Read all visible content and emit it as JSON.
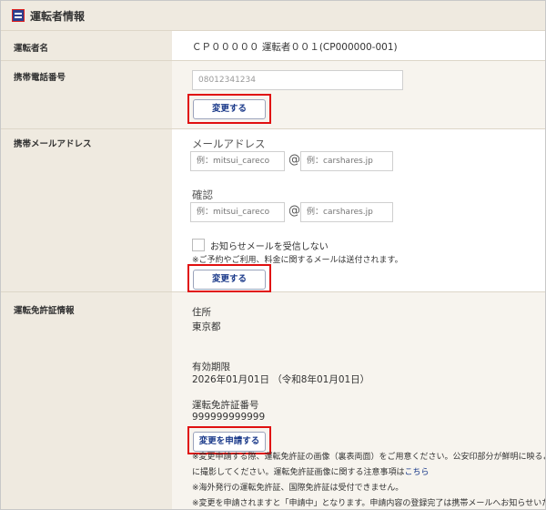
{
  "header": {
    "title": "運転者情報"
  },
  "driver_name": {
    "label": "運転者名",
    "value": "ＣＰ０００００ 運転者００１(CP000000-001)"
  },
  "mobile_phone": {
    "label": "携帯電話番号",
    "input_value": "08012341234",
    "button": "変更する"
  },
  "mobile_email": {
    "label": "携帯メールアドレス",
    "email_heading": "メールアドレス",
    "local_placeholder": "例：mitsui_careco",
    "at": "@",
    "domain_placeholder": "例：carshares.jp",
    "confirm_heading": "確認",
    "notify_checkbox_label": "お知らせメールを受信しない",
    "notify_note": "※ご予約やご利用、料金に関するメールは送付されます。",
    "button": "変更する"
  },
  "license": {
    "label": "運転免許証情報",
    "address_label": "住所",
    "address_value": "東京都",
    "expiry_label": "有効期限",
    "expiry_value": "2026年01月01日 （令和8年01月01日）",
    "number_label": "運転免許証番号",
    "number_value": "999999999999",
    "button": "変更を申請する",
    "note1": "※変更申請する際、運転免許証の画像（裏表両面）をご用意ください。公安印部分が鮮明に映るよう",
    "note2_prefix": "に撮影してください。運転免許証画像に関する注意事項は",
    "note2_link": "こちら",
    "note3": "※海外発行の運転免許証、国際免許証は受付できません。",
    "note4": "※変更を申請されますと「申請中」となります。申請内容の登録完了は携帯メールへお知らせいたし"
  }
}
